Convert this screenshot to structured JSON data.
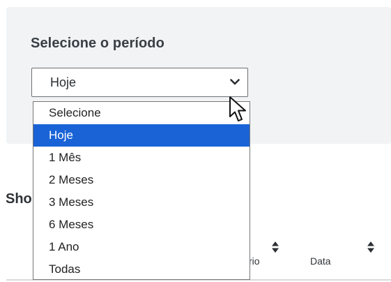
{
  "filter": {
    "label": "Selecione o período",
    "selected_value": "Hoje",
    "options": [
      {
        "label": "Selecione",
        "selected": false
      },
      {
        "label": "Hoje",
        "selected": true
      },
      {
        "label": "1 Mês",
        "selected": false
      },
      {
        "label": "2 Meses",
        "selected": false
      },
      {
        "label": "3 Meses",
        "selected": false
      },
      {
        "label": "6 Meses",
        "selected": false
      },
      {
        "label": "1 Ano",
        "selected": false
      },
      {
        "label": "Todas",
        "selected": false
      }
    ]
  },
  "section": {
    "heading_partial": "Sho"
  },
  "table": {
    "columns": [
      {
        "label": "rio"
      },
      {
        "label": "Data"
      }
    ]
  },
  "colors": {
    "panel_bg": "#f1f3f5",
    "selected_option_bg": "#1a63d6",
    "selected_option_text": "#ffffff"
  },
  "icons": {
    "select_chevron": "chevron-down-icon",
    "sort": "sort-icon",
    "cursor": "mouse-pointer-icon"
  }
}
